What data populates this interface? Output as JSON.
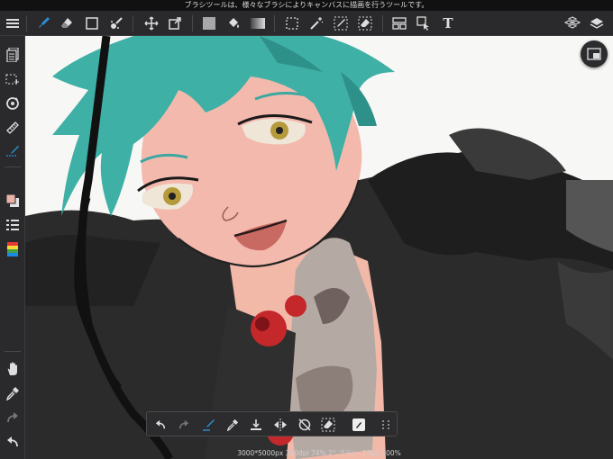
{
  "status_message": "ブラシツールは、様々なブラシによりキャンバスに描画を行うツールです。",
  "toolbar": {
    "items": [
      {
        "name": "menu-icon"
      },
      {
        "name": "brush-tool-icon",
        "active": true
      },
      {
        "name": "eraser-tool-icon"
      },
      {
        "name": "shape-tool-icon"
      },
      {
        "name": "blur-tool-icon"
      },
      {
        "name": "move-tool-icon"
      },
      {
        "name": "transform-tool-icon"
      },
      {
        "name": "fill-color-icon"
      },
      {
        "name": "bucket-tool-icon"
      },
      {
        "name": "gradation-tool-icon"
      },
      {
        "name": "select-tool-icon"
      },
      {
        "name": "magic-wand-icon"
      },
      {
        "name": "select-pen-icon"
      },
      {
        "name": "select-eraser-icon"
      },
      {
        "name": "frame-divider-icon"
      },
      {
        "name": "operation-tool-icon"
      },
      {
        "name": "text-tool-icon",
        "label": "T"
      },
      {
        "name": "materials-icon"
      },
      {
        "name": "layers-icon"
      }
    ]
  },
  "sidebar": {
    "items": [
      {
        "name": "page-manager-icon"
      },
      {
        "name": "selection-icon"
      },
      {
        "name": "rotate-canvas-icon"
      },
      {
        "name": "ruler-icon"
      },
      {
        "name": "snap-brush-icon",
        "active": true
      },
      {
        "name": "color-swatch-icon"
      },
      {
        "name": "brush-settings-icon"
      },
      {
        "name": "palette-icon"
      },
      {
        "name": "hand-tool-icon"
      },
      {
        "name": "eyedropper-icon"
      },
      {
        "name": "redo-icon"
      },
      {
        "name": "undo-icon"
      }
    ]
  },
  "bottom_toolbar": {
    "items": [
      {
        "name": "undo-icon"
      },
      {
        "name": "redo-icon"
      },
      {
        "name": "brush-quick-icon"
      },
      {
        "name": "eyedropper-icon"
      },
      {
        "name": "save-icon"
      },
      {
        "name": "flip-icon"
      },
      {
        "name": "rotate-reset-icon"
      },
      {
        "name": "eraser-quick-icon"
      },
      {
        "name": "fill-toggle-icon"
      },
      {
        "name": "more-icon"
      }
    ]
  },
  "canvas_info": "3000*5000px 350dpi 74% 2° ブラシ: 19px 100%",
  "colors": {
    "accent": "#2a8fd6",
    "toolbar_bg": "#2a2a2c",
    "canvas_bg": "#f7f7f5"
  }
}
